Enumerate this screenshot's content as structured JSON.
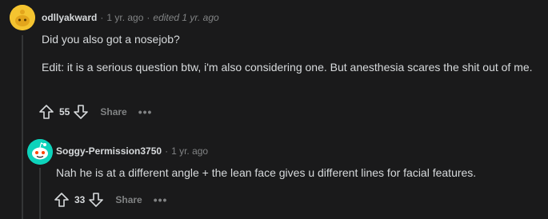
{
  "comments": [
    {
      "username": "odllyakward",
      "age": "1 yr. ago",
      "edited": "edited 1 yr. ago",
      "paragraphs": [
        "Did you also got a nosejob?",
        "Edit: it is a serious question btw, i'm also considering one. But anesthesia scares the shit out of me."
      ],
      "votes": "55",
      "share_label": "Share",
      "more_label": "•••",
      "avatar_color": "#f4c430"
    },
    {
      "username": "Soggy-Permission3750",
      "age": "1 yr. ago",
      "paragraphs": [
        "Nah he is at a different angle + the lean face gives u different lines for facial features."
      ],
      "votes": "33",
      "share_label": "Share",
      "more_label": "•••",
      "avatar_color": "#0dd3bb"
    }
  ],
  "icons": {
    "upvote": "arrow-up-icon",
    "downvote": "arrow-down-icon"
  },
  "colors": {
    "background": "#1a1a1b",
    "text": "#d7dadc",
    "muted": "#818384",
    "thread_line": "#343536"
  }
}
